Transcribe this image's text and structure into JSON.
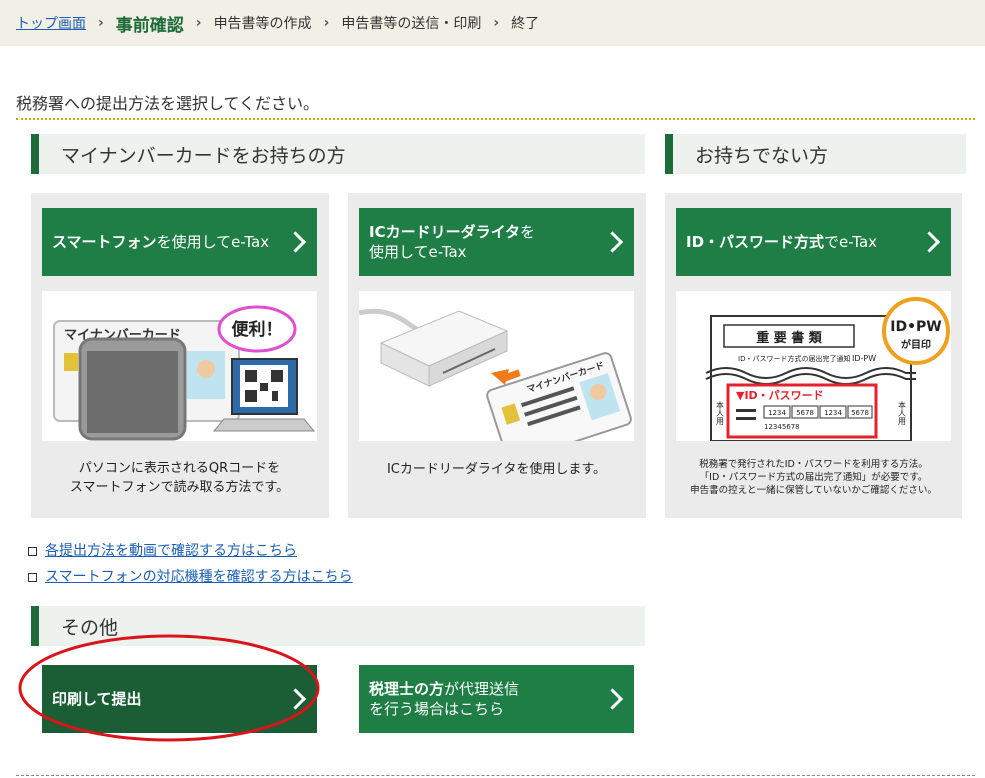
{
  "breadcrumb": {
    "top": "トップ画面",
    "current": "事前確認",
    "step3": "申告書等の作成",
    "step4": "申告書等の送信・印刷",
    "step5": "終了",
    "separator": "›"
  },
  "instruction": "税務署への提出方法を選択してください。",
  "section_mynumber": {
    "title": "マイナンバーカードをお持ちの方"
  },
  "section_none": {
    "title": "お持ちでない方"
  },
  "option_smartphone": {
    "label_bold": "スマートフォン",
    "label_rest": "を使用してe-Tax",
    "card_text": "マイナンバーカード",
    "bubble": "便利！",
    "desc1": "パソコンに表示されるQRコードを",
    "desc2": "スマートフォンで読み取る方法です。"
  },
  "option_icreader": {
    "label_bold": "ICカードリーダライタ",
    "label_rest1": "を",
    "label_rest2": "使用してe-Tax",
    "card_text": "マイナンバーカード",
    "desc": "ICカードリーダライタを使用します。"
  },
  "option_idpw": {
    "label_bold": "ID・パスワード方式",
    "label_rest": "でe-Tax",
    "doc_title": "重 要 書 類",
    "doc_sub": "ID・パスワード方式の届出完了通知",
    "doc_idpw": "ID-PW",
    "badge1": "ID•PW",
    "badge2": "が目印",
    "pw_label": "▼ID・パスワード",
    "cells": [
      "1234",
      "5678",
      "1234",
      "5678"
    ],
    "small_num": "12345678",
    "side_label": "本人用",
    "desc1": "税務署で発行されたID・パスワードを利用する方法。",
    "desc2": "「ID・パスワード方式の届出完了通知」が必要です。",
    "desc3": "申告書の控えと一緒に保管していないかご確認ください。"
  },
  "links": [
    "各提出方法を動画で確認する方はこちら",
    "スマートフォンの対応機種を確認する方はこちら"
  ],
  "section_other": {
    "title": "その他"
  },
  "option_print": {
    "label": "印刷して提出"
  },
  "option_taxaccountant": {
    "label_bold": "税理士の方",
    "label_rest1": "が代理送信",
    "label_rest2": "を行う場合はこちら"
  },
  "colors": {
    "green": "#1e7e45",
    "dark_green": "#1b5e35",
    "highlight_oval": "#d9141b",
    "link": "#1a5fb4"
  }
}
